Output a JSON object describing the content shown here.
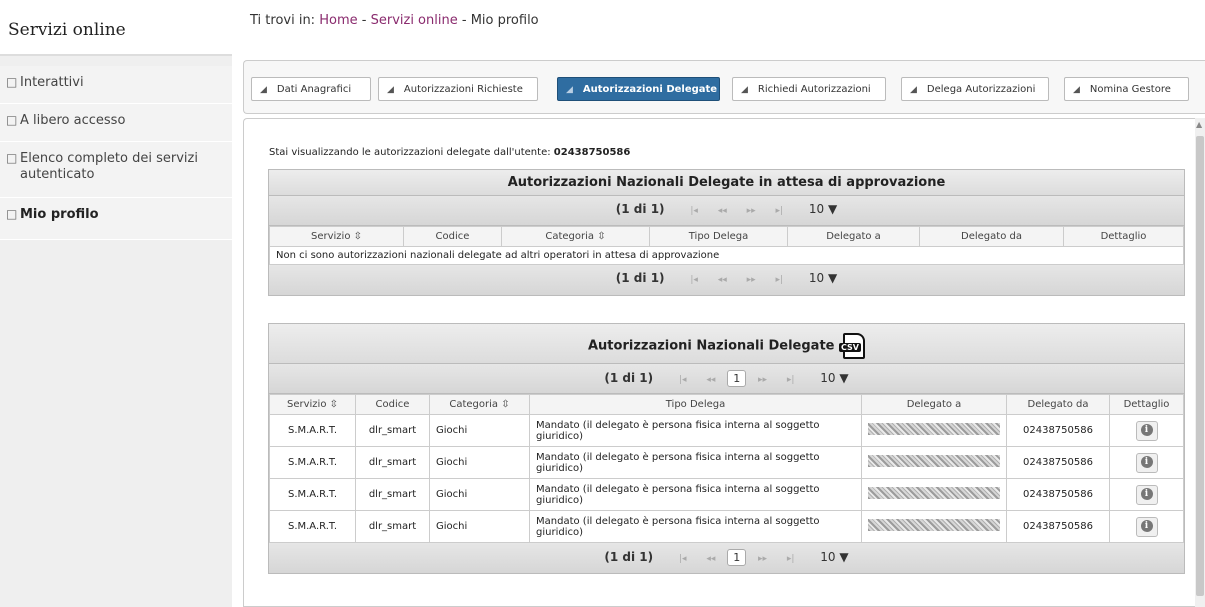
{
  "sidebar": {
    "title": "Servizi online",
    "items": [
      {
        "label": "Interattivi"
      },
      {
        "label": "A libero accesso"
      },
      {
        "label": "Elenco completo dei servizi autenticato"
      },
      {
        "label": "Mio profilo"
      }
    ]
  },
  "breadcrumb": {
    "prefix": "Ti trovi in:",
    "home": "Home",
    "sep1": "-",
    "servizi": "Servizi online",
    "sep2": "-",
    "current": "Mio profilo"
  },
  "tabs": [
    {
      "label": "Dati Anagrafici"
    },
    {
      "label": "Autorizzazioni Richieste"
    },
    {
      "label": "Autorizzazioni Delegate"
    },
    {
      "label": "Richiedi Autorizzazioni"
    },
    {
      "label": "Delega Autorizzazioni"
    },
    {
      "label": "Nomina Gestore"
    }
  ],
  "intro": {
    "text": "Stai visualizzando le autorizzazioni delegate dall'utente:",
    "user": "02438750586"
  },
  "pending": {
    "title": "Autorizzazioni Nazionali Delegate in attesa di approvazione",
    "pager_count": "(1 di 1)",
    "rows_per_page": "10 ▼",
    "headers": [
      "Servizio ⇳",
      "Codice",
      "Categoria ⇳",
      "Tipo Delega",
      "Delegato a",
      "Delegato da",
      "Dettaglio"
    ],
    "empty_message": "Non ci sono autorizzazioni nazionali delegate ad altri operatori in attesa di approvazione"
  },
  "delegated": {
    "title": "Autorizzazioni Nazionali Delegate",
    "csv_label": "CSV",
    "pager_count": "(1 di 1)",
    "page": "1",
    "rows_per_page": "10 ▼",
    "headers": [
      "Servizio ⇳",
      "Codice",
      "Categoria ⇳",
      "Tipo Delega",
      "Delegato a",
      "Delegato da",
      "Dettaglio"
    ],
    "rows": [
      {
        "servizio": "S.M.A.R.T.",
        "codice": "dlr_smart",
        "categoria": "Giochi",
        "tipo": "Mandato (il delegato è persona fisica interna al soggetto giuridico)",
        "delegato_da": "02438750586"
      },
      {
        "servizio": "S.M.A.R.T.",
        "codice": "dlr_smart",
        "categoria": "Giochi",
        "tipo": "Mandato (il delegato è persona fisica interna al soggetto giuridico)",
        "delegato_da": "02438750586"
      },
      {
        "servizio": "S.M.A.R.T.",
        "codice": "dlr_smart",
        "categoria": "Giochi",
        "tipo": "Mandato (il delegato è persona fisica interna al soggetto giuridico)",
        "delegato_da": "02438750586"
      },
      {
        "servizio": "S.M.A.R.T.",
        "codice": "dlr_smart",
        "categoria": "Giochi",
        "tipo": "Mandato (il delegato è persona fisica interna al soggetto giuridico)",
        "delegato_da": "02438750586"
      }
    ]
  },
  "pager_nav": {
    "first": "|◂",
    "prev": "◂◂",
    "next": "▸▸",
    "last": "▸|"
  },
  "icons": {
    "sidebar_bullet": "□",
    "tab_marker": "◢",
    "info": "i"
  },
  "colors": {
    "link": "#8a2b6e",
    "active_tab": "#2f6da1"
  }
}
